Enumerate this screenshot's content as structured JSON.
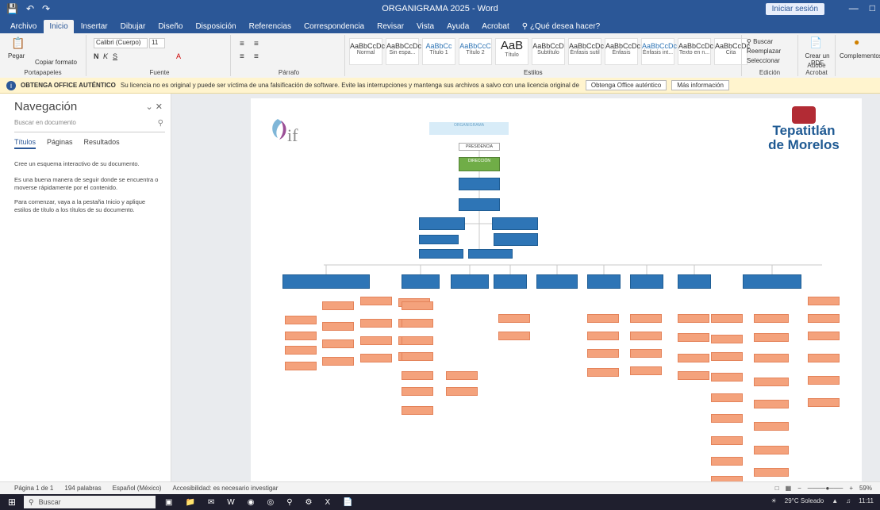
{
  "window": {
    "title": "ORGANIGRAMA 2025 - Word",
    "signin_label": "Iniciar sesión"
  },
  "ribbon_tabs": [
    "Archivo",
    "Inicio",
    "Insertar",
    "Dibujar",
    "Diseño",
    "Disposición",
    "Referencias",
    "Correspondencia",
    "Revisar",
    "Vista",
    "Ayuda",
    "Acrobat"
  ],
  "tell_me": "¿Qué desea hacer?",
  "ribbon": {
    "paste_label": "Pegar",
    "copy_format_label": "Copiar formato",
    "clipboard_label": "Portapapeles",
    "font_label": "Fuente",
    "font_name": "Calibri (Cuerpo)",
    "font_size": "11",
    "paragraph_label": "Párrafo",
    "styles_label": "Estilos",
    "styles": [
      {
        "sample": "AaBbCcDc",
        "name": "Normal"
      },
      {
        "sample": "AaBbCcDc",
        "name": "Sin espa..."
      },
      {
        "sample": "AaBbCc",
        "name": "Título 1"
      },
      {
        "sample": "AaBbCcC",
        "name": "Título 2"
      },
      {
        "sample": "AaB",
        "name": "Título"
      },
      {
        "sample": "AaBbCcD",
        "name": "Subtítulo"
      },
      {
        "sample": "AaBbCcDc",
        "name": "Énfasis sutil"
      },
      {
        "sample": "AaBbCcDc",
        "name": "Énfasis"
      },
      {
        "sample": "AaBbCcDc",
        "name": "Énfasis int..."
      },
      {
        "sample": "AaBbCcDc",
        "name": "Texto en n..."
      },
      {
        "sample": "AaBbCcDc",
        "name": "Cita"
      }
    ],
    "find_label": "Buscar",
    "replace_label": "Reemplazar",
    "select_label": "Seleccionar",
    "editing_label": "Edición",
    "create_pdf_label": "Crear un PDF",
    "adobe_label": "Adobe Acrobat",
    "addins_label": "Complementos"
  },
  "message_bar": {
    "title": "OBTENGA OFFICE AUTÉNTICO",
    "text": "Su licencia no es original y puede ser víctima de una falsificación de software. Evite las interrupciones y mantenga sus archivos a salvo con una licencia original de Office hoy mismo.",
    "button_primary": "Obtenga Office auténtico",
    "button_secondary": "Más información"
  },
  "navigation": {
    "title": "Navegación",
    "search_placeholder": "Buscar en documento",
    "tabs": [
      "Títulos",
      "Páginas",
      "Resultados"
    ],
    "paragraphs": [
      "Cree un esquema interactivo de su documento.",
      "Es una buena manera de seguir donde se encuentra o moverse rápidamente por el contenido.",
      "Para comenzar, vaya a la pestaña Inicio y aplique estilos de título a los títulos de su documento."
    ]
  },
  "document": {
    "logo_left_text": "if",
    "logo_right_line1": "Tepatitlán",
    "logo_right_line2": "de Morelos",
    "org_title": "ORGANIGRAMA",
    "root_label": "PRESIDENCIA",
    "director_label": "DIRECCIÓN"
  },
  "statusbar": {
    "page": "Página 1 de 1",
    "words": "194 palabras",
    "language": "Español (México)",
    "accessibility": "Accesibilidad: es necesario investigar",
    "zoom": "59%"
  },
  "taskbar": {
    "search_placeholder": "Buscar",
    "weather": "29°C Soleado",
    "clock": "11:11"
  }
}
